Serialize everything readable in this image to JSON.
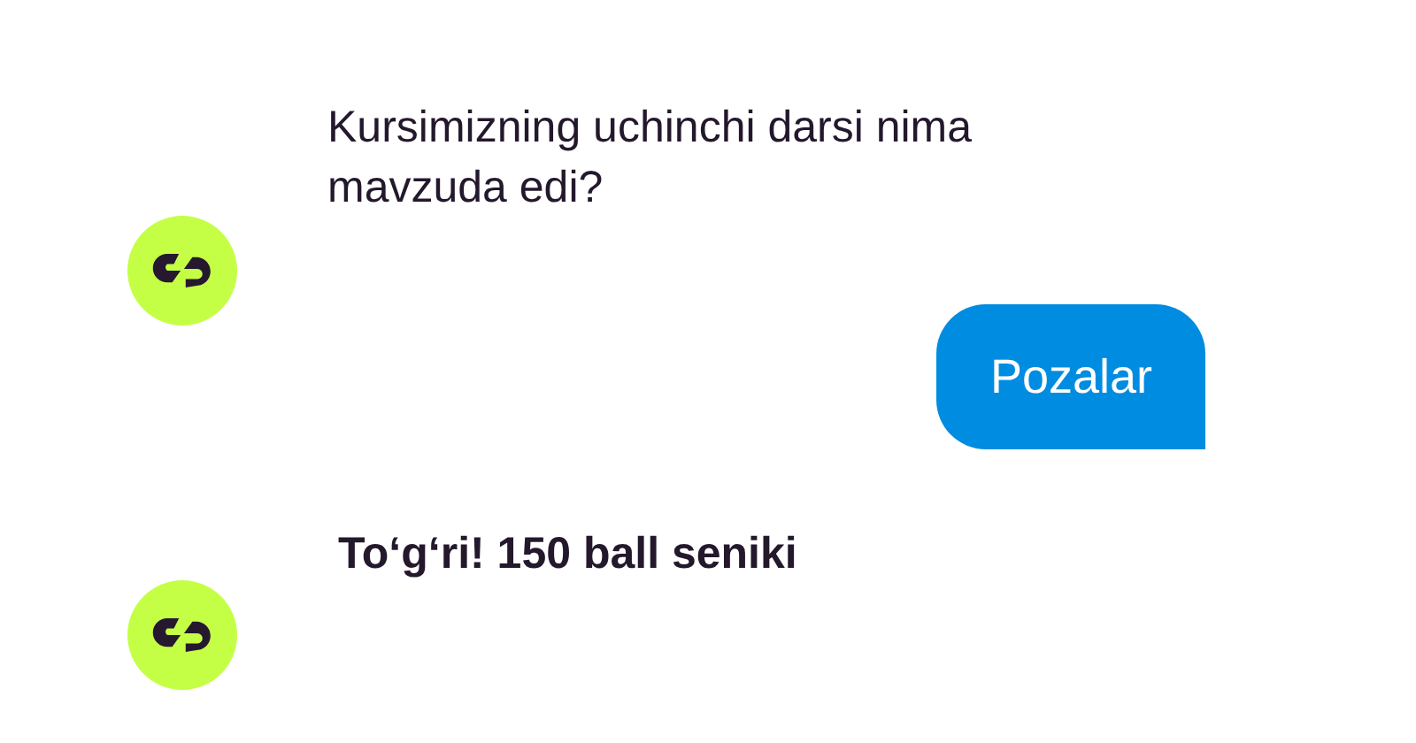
{
  "messages": [
    {
      "kind": "bot",
      "text": "Kursimizning uchinchi darsi nima mavzuda edi?",
      "bold": false
    },
    {
      "kind": "user",
      "text": "Pozalar"
    },
    {
      "kind": "bot",
      "text": "To‘g‘ri! 150 ball seniki",
      "bold": true
    }
  ]
}
